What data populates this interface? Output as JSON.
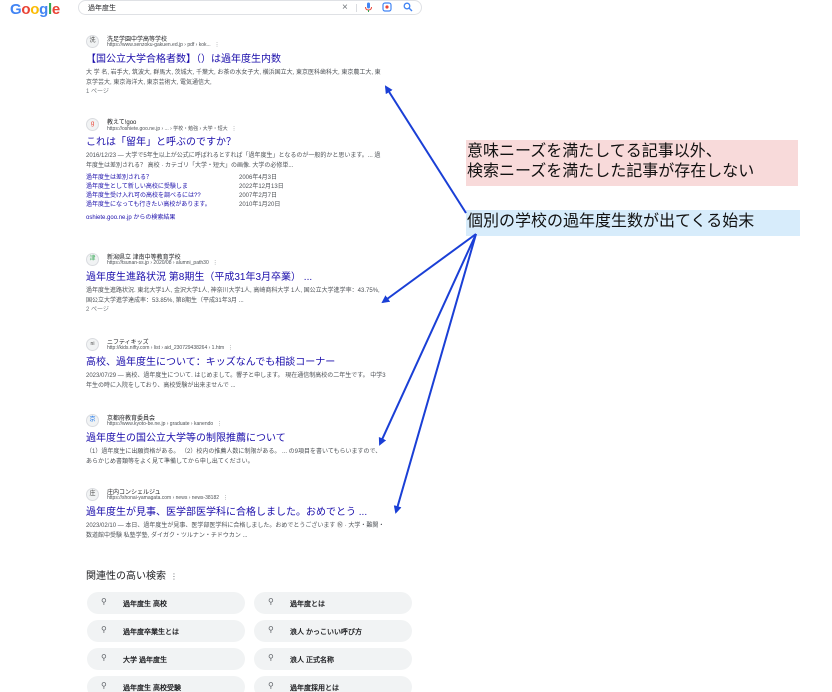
{
  "header": {
    "logo_letters": [
      "G",
      "o",
      "o",
      "g",
      "l",
      "e"
    ],
    "logo_colors": [
      "#4285f4",
      "#ea4335",
      "#fbbc05",
      "#4285f4",
      "#34a853",
      "#ea4335"
    ],
    "query": "過年度生"
  },
  "results": [
    {
      "site_name": "洗足学園中学高等学校",
      "url": "https://www.senzoku-gakuen.ed.jp › pdf › kok...",
      "favicon": "洗",
      "title": "【国公立大学合格者数】（）は過年度生内数",
      "snippet": "大 学 名, 岩手大, 筑波大, 群馬大, 茨城大, 千葉大, お茶の水女子大, 横浜国立大, 東京医科歯科大, 東京農工大, 東京学芸大, 東京海洋大, 東京芸術大, 電気通信大,",
      "pages": "1 ページ"
    },
    {
      "site_name": "教えて!goo",
      "url": "https://oshiete.goo.ne.jp › ... › 学校・勉強 › 大学・短大",
      "favicon": "g",
      "title": "これは「留年」と呼ぶのですか？",
      "snippet": "2016/12/23 — 大学で5年生以上が公式に呼ばれるとすれば「過年度生」となるのが一般的かと思います。... 過年度生は差別される？ 高校 · カテゴリ「大学・短大」の画像. 大学の必修単...",
      "sublinks": [
        {
          "title": "過年度生は差別される？",
          "date": "2006年4月3日"
        },
        {
          "title": "過年度生として新しい高校に受験しま",
          "date": "2022年12月13日"
        },
        {
          "title": "過年度生受け入れ可の高校を調べるには??",
          "date": "2007年2月7日"
        },
        {
          "title": "過年度生になっても行きたい高校があります。",
          "date": "2010年1月20日"
        }
      ],
      "more": "oshiete.goo.ne.jp からの検索結果"
    },
    {
      "site_name": "新潟県立 津南中等教育学校",
      "url": "https://tsunan-ss.jp › 2020/08 › alumni_path30",
      "favicon": "津",
      "title": "過年度生進路状況 第8期生（平成31年3月卒業） ...",
      "snippet": "過年度生進路状況. 東北大学1人, 金沢大学1人, 神奈川大学1人, 高崎商科大学 1人, 国公立大学進学率：43.75%, 国公立大学進学達成率：53.85%, 第8期生（平成31年3月 ...",
      "pages": "2 ページ"
    },
    {
      "site_name": "ニフティキッズ",
      "url": "http://kids.nifty.com › list › aid_230729438264 › 1.htm",
      "favicon": "ni",
      "title": "高校、過年度生について：キッズなんでも相談コーナー",
      "snippet": "2023/07/29 — 高校、過年度生について. はじめまして。響子と申します。 現在通信制高校の二年生です。 中学3年生の時に入院をしており、高校受験が出来ませんで ..."
    },
    {
      "site_name": "京都府教育委員会",
      "url": "https://www.kyoto-be.ne.jp › graduate › kanendo",
      "favicon": "京",
      "title": "過年度生の国公立大学等の制限推薦について",
      "snippet": "（1）過年度生に出願資格がある。 （2）校内の推薦人数に制限がある。 ... の9項目を書いてもらいますので、あらかじめ書類等をよく見て準備してから申し出てください。"
    },
    {
      "site_name": "庄内コンシェルジュ",
      "url": "https://shonai-yamagata.com › news › news-38182",
      "favicon": "庄",
      "title": "過年度生が見事、医学部医学科に合格しました。おめでとう ...",
      "snippet": "2023/02/10 — 本日、過年度生が見事、医学部医学科に合格しました。おめでとうございます ㊗ · 大学・難関・数道館中受験 私塾学塾, ダイガク・ツルナン・チドウカン ..."
    }
  ],
  "related": {
    "heading": "関連性の高い検索",
    "items": [
      "過年度生 高校",
      "過年度とは",
      "過年度卒業生とは",
      "浪人 かっこいい呼び方",
      "大学 過年度生",
      "浪人 正式名称",
      "過年度生 高校受験",
      "過年度採用とは"
    ]
  },
  "annotations": {
    "pink_line1": "意味ニーズを満たしてる記事以外、",
    "pink_line2": "検索ニーズを満たした記事が存在しない",
    "blue": "個別の学校の過年度生数が出てくる始末",
    "arrow_color": "#1a3fd6"
  }
}
